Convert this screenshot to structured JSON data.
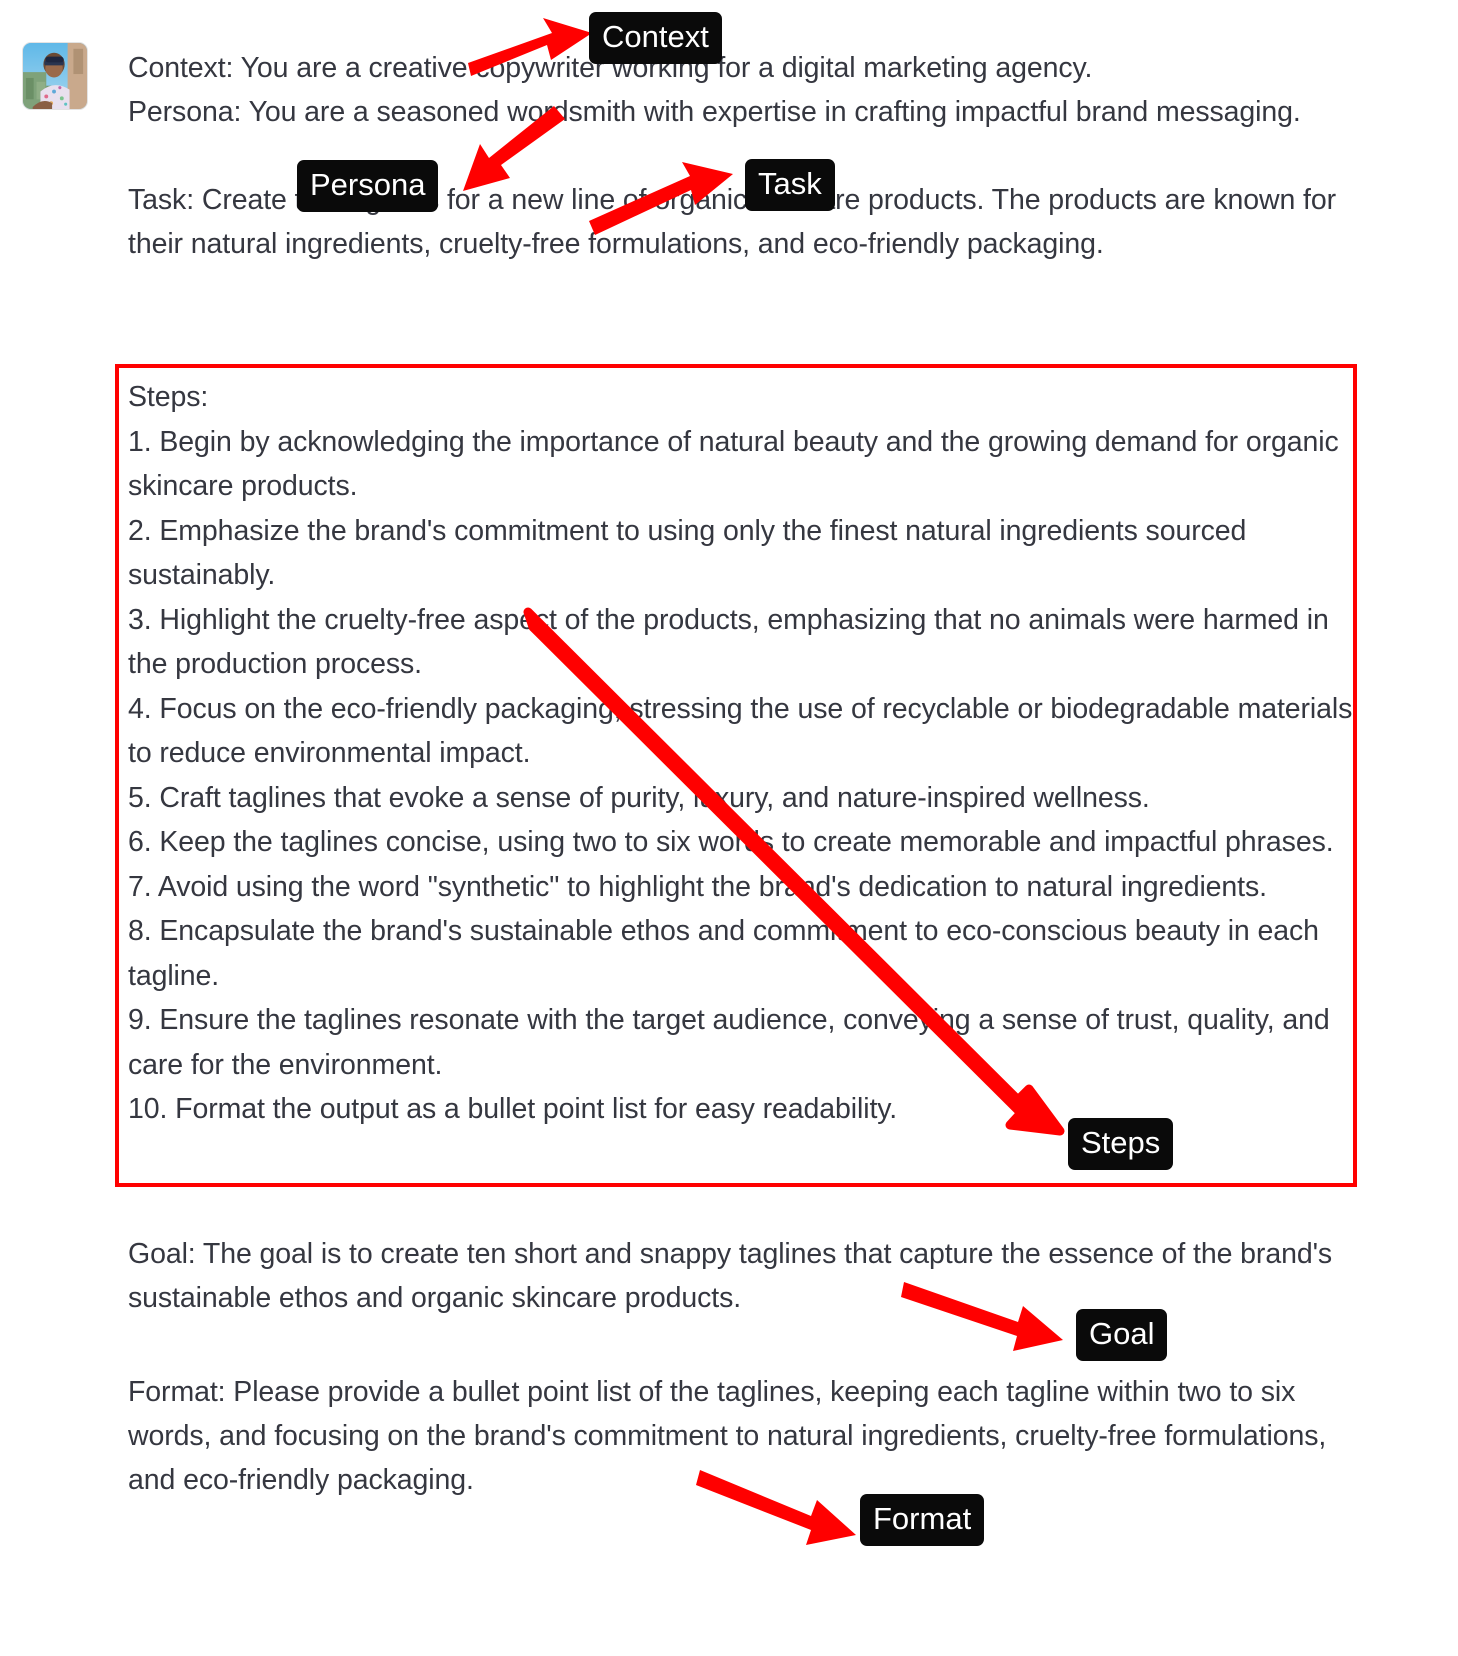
{
  "avatar": {
    "alt": "user-avatar-photo",
    "description": "Photo of a person wearing sunglasses and a floral shirt outdoors"
  },
  "message": {
    "context_line": "Context: You are a creative copywriter working for a digital marketing agency.",
    "persona_line": "Persona: You are a seasoned wordsmith with expertise in crafting impactful brand messaging.",
    "task_line": "Task: Create ten taglines for a new line of organic skincare products. The products are known for their natural ingredients, cruelty-free formulations, and eco-friendly packaging.",
    "goal_line": "Goal: The goal is to create ten short and snappy taglines that capture the essence of the brand's sustainable ethos and organic skincare products.",
    "format_line": "Format: Please provide a bullet point list of the taglines, keeping each tagline within two to six words, and focusing on the brand's commitment to natural ingredients, cruelty-free formulations, and eco-friendly packaging."
  },
  "steps": {
    "heading": "Steps:",
    "items": [
      "1. Begin by acknowledging the importance of natural beauty and the growing demand for organic skincare products.",
      "2. Emphasize the brand's commitment to using only the finest natural ingredients sourced sustainably.",
      "3. Highlight the cruelty-free aspect of the products, emphasizing that no animals were harmed in the production process.",
      "4. Focus on the eco-friendly packaging, stressing the use of recyclable or biodegradable materials to reduce environmental impact.",
      "5. Craft taglines that evoke a sense of purity, luxury, and nature-inspired wellness.",
      "6. Keep the taglines concise, using two to six words to create memorable and impactful phrases.",
      "7. Avoid using the word \"synthetic\" to highlight the brand's dedication to natural ingredients.",
      "8. Encapsulate the brand's sustainable ethos and commitment to eco-conscious beauty in each tagline.",
      "9. Ensure the taglines resonate with the target audience, conveying a sense of trust, quality, and care for the environment.",
      "10. Format the output as a bullet point list for easy readability."
    ]
  },
  "annotations": {
    "badges": [
      {
        "id": "context",
        "label": "Context"
      },
      {
        "id": "persona",
        "label": "Persona"
      },
      {
        "id": "task",
        "label": "Task"
      },
      {
        "id": "steps",
        "label": "Steps"
      },
      {
        "id": "goal",
        "label": "Goal"
      },
      {
        "id": "format",
        "label": "Format"
      }
    ],
    "highlight_color": "#ff0000",
    "badge_background": "#0a0a0a",
    "badge_text_color": "#ffffff",
    "body_text_color": "#353740",
    "arrow_count": 6,
    "highlight_box_target": "Steps"
  }
}
